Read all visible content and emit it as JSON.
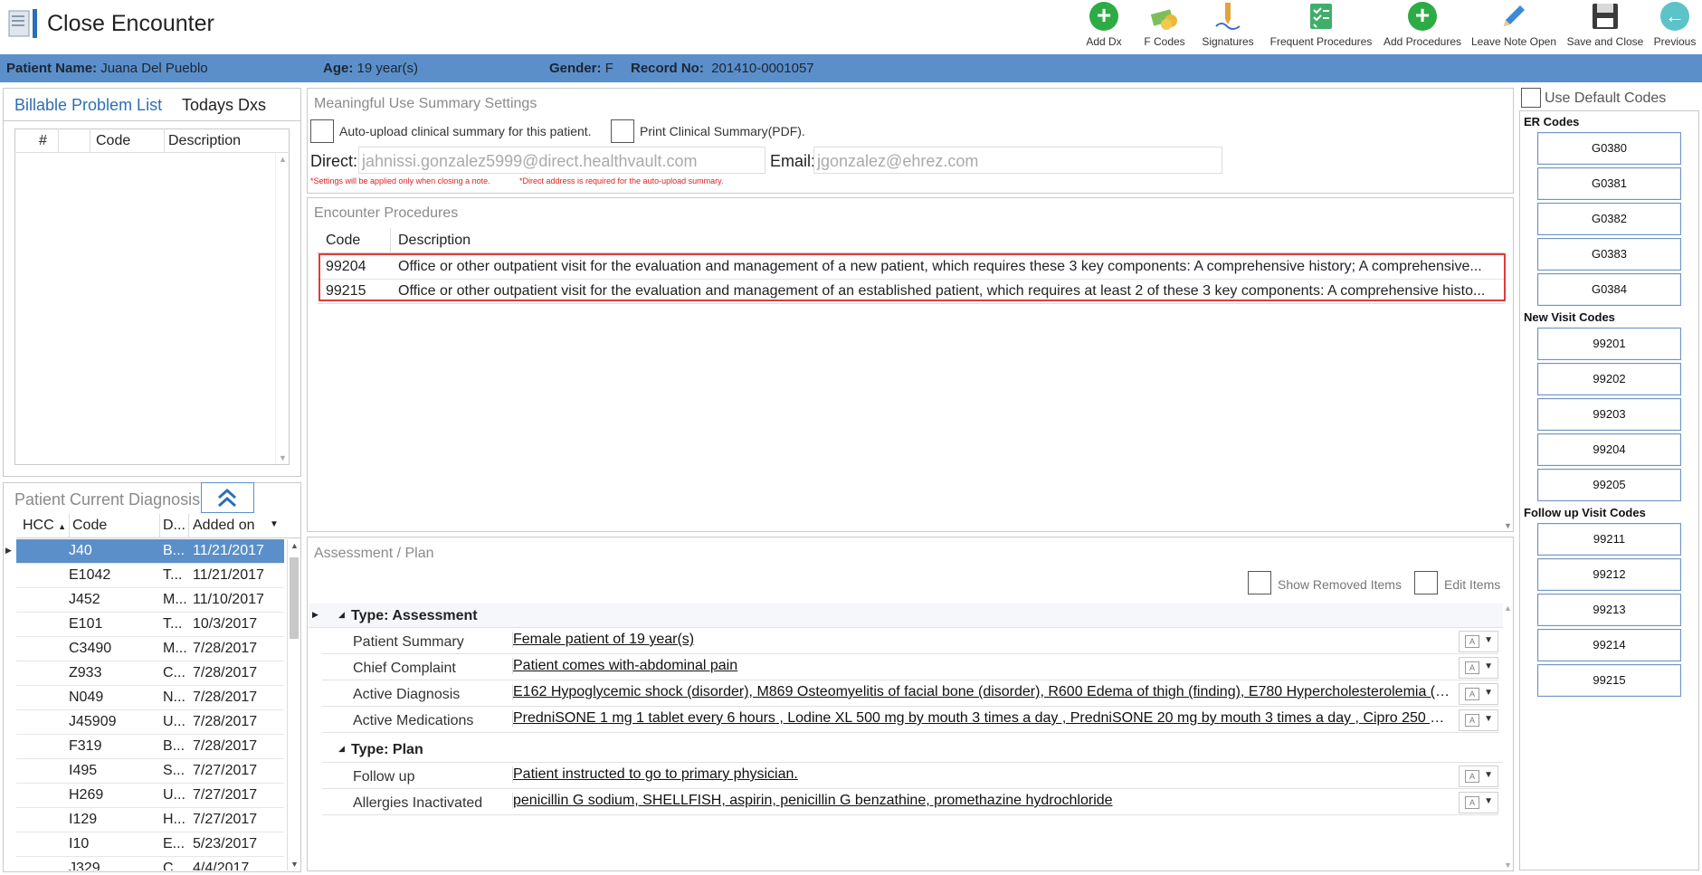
{
  "app": {
    "title": "Close Encounter"
  },
  "toolbar": {
    "add_dx": "Add Dx",
    "f_codes": "F Codes",
    "signatures": "Signatures",
    "frequent_procedures": "Frequent Procedures",
    "add_procedures": "Add Procedures",
    "leave_note_open": "Leave Note Open",
    "save_and_close": "Save and Close",
    "previous": "Previous"
  },
  "patient": {
    "name_label": "Patient Name:",
    "name": "Juana Del Pueblo",
    "age_label": "Age:",
    "age": "19 year(s)",
    "gender_label": "Gender:",
    "gender": "F",
    "record_label": "Record No:",
    "record": "201410-0001057"
  },
  "problem_list": {
    "tab_billable": "Billable Problem List",
    "tab_todays": "Todays Dxs",
    "col_num": "#",
    "col_code": "Code",
    "col_desc": "Description"
  },
  "current_dx": {
    "title": "Patient Current Diagnosis",
    "col_hcc": "HCC",
    "col_code": "Code",
    "col_d": "D...",
    "col_added": "Added on",
    "rows": [
      {
        "code": "J40",
        "d": "B...",
        "added": "11/21/2017"
      },
      {
        "code": "E1042",
        "d": "T...",
        "added": "11/21/2017"
      },
      {
        "code": "J452",
        "d": "M...",
        "added": "11/10/2017"
      },
      {
        "code": "E101",
        "d": "T...",
        "added": "10/3/2017"
      },
      {
        "code": "C3490",
        "d": "M...",
        "added": "7/28/2017"
      },
      {
        "code": "Z933",
        "d": "C...",
        "added": "7/28/2017"
      },
      {
        "code": "N049",
        "d": "N...",
        "added": "7/28/2017"
      },
      {
        "code": "J45909",
        "d": "U...",
        "added": "7/28/2017"
      },
      {
        "code": "F319",
        "d": "B...",
        "added": "7/28/2017"
      },
      {
        "code": "I495",
        "d": "S...",
        "added": "7/27/2017"
      },
      {
        "code": "H269",
        "d": "U...",
        "added": "7/27/2017"
      },
      {
        "code": "I129",
        "d": "H...",
        "added": "7/27/2017"
      },
      {
        "code": "I10",
        "d": "E...",
        "added": "5/23/2017"
      },
      {
        "code": "J329",
        "d": "C...",
        "added": "4/4/2017"
      }
    ]
  },
  "mu": {
    "title": "Meaningful Use Summary Settings",
    "auto_upload": "Auto-upload clinical summary for this patient.",
    "print_summary": "Print Clinical Summary(PDF).",
    "direct_label": "Direct:",
    "direct_value": "jahnissi.gonzalez5999@direct.healthvault.com",
    "email_label": "Email:",
    "email_value": "jgonzalez@ehrez.com",
    "note1": "*Settings will be applied only when closing a note.",
    "note2": "*Direct address is required for the auto-upload summary."
  },
  "procedures": {
    "title": "Encounter Procedures",
    "col_code": "Code",
    "col_desc": "Description",
    "rows": [
      {
        "code": "99204",
        "desc": "Office or other outpatient visit for the evaluation and management of a new patient, which requires these 3 key components: A comprehensive history; A comprehensive..."
      },
      {
        "code": "99215",
        "desc": "Office or other outpatient visit for the evaluation and management of an established patient, which requires at least 2 of these 3 key components: A comprehensive histo..."
      }
    ]
  },
  "assessment": {
    "title": "Assessment / Plan",
    "show_removed": "Show Removed Items",
    "edit_items": "Edit Items",
    "type_assessment": "Type: Assessment",
    "type_plan": "Type: Plan",
    "rows_assessment": [
      {
        "label": "Patient Summary",
        "value": "Female patient of 19 year(s)"
      },
      {
        "label": "Chief Complaint",
        "value": "Patient comes with-abdominal pain "
      },
      {
        "label": "Active Diagnosis",
        "value": "E162 Hypoglycemic shock (disorder), M869 Osteomyelitis of facial bone (disorder), R600 Edema of thigh (finding), E780 Hypercholesterolemia (dis..."
      },
      {
        "label": "Active Medications",
        "value": "PredniSONE 1 mg 1 tablet every 6 hours , Lodine XL 500 mg by mouth 3 times a day , PredniSONE 20 mg by mouth 3 times a day , Cipro 250 mg..."
      }
    ],
    "rows_plan": [
      {
        "label": "Follow up",
        "value": "Patient instructed to go to primary physician."
      },
      {
        "label": "Allergies Inactivated",
        "value": "penicillin G sodium, SHELLFISH, aspirin, penicillin G benzathine, promethazine hydrochloride"
      }
    ]
  },
  "codes": {
    "use_default": "Use Default Codes",
    "er_title": "ER Codes",
    "er": [
      "G0380",
      "G0381",
      "G0382",
      "G0383",
      "G0384"
    ],
    "new_title": "New Visit Codes",
    "new": [
      "99201",
      "99202",
      "99203",
      "99204",
      "99205"
    ],
    "follow_title": "Follow up Visit Codes",
    "follow": [
      "99211",
      "99212",
      "99213",
      "99214",
      "99215"
    ]
  },
  "colors": {
    "accent": "#5b8fc9",
    "highlight_box": "#e03b3b",
    "green": "#2eab45"
  }
}
